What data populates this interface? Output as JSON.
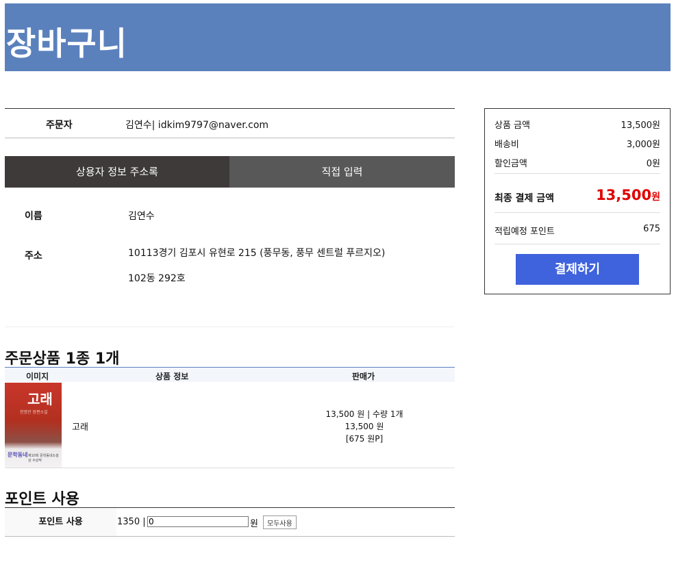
{
  "header": {
    "title": "장바구니"
  },
  "orderer": {
    "label": "주문자",
    "value": "김연수| idkim9797@naver.com"
  },
  "address_tabs": [
    {
      "label": "상용자 정보 주소록"
    },
    {
      "label": "직접 입력"
    }
  ],
  "recipient": {
    "name_label": "이름",
    "name_value": "김연수",
    "address_label": "주소",
    "address_line1": "10113경기 김포시 유현로 215 (풍무동, 풍무 센트럴 푸르지오)",
    "address_line2": "102동 292호"
  },
  "products": {
    "heading": "주문상품 1종 1개",
    "columns": [
      "이미지",
      "상품 정보",
      "판매가"
    ],
    "items": [
      {
        "cover_title": "고래",
        "cover_subtitle": "천명관 장편소설",
        "cover_logo": "문학동네",
        "cover_footer": "제10회 문학동네소설상 수상작",
        "name": "고래",
        "price_line": "13,500 원 | 수량 1개",
        "subtotal": "13,500 원",
        "points": "[675 원P]"
      }
    ]
  },
  "points_use": {
    "heading": "포인트 사용",
    "label": "포인트 사용",
    "available": "1350 |",
    "input_value": "0",
    "unit": "원",
    "use_all_label": "모두사용"
  },
  "summary": {
    "product_amount_label": "상품 금액",
    "product_amount": "13,500원",
    "shipping_label": "배송비",
    "shipping": "3,000원",
    "discount_label": "할인금액",
    "discount": "0원",
    "final_label": "최종 결제 금액",
    "final_amount": "13,500",
    "final_unit": "원",
    "points_label": "적립예정 포인트",
    "points": "675",
    "pay_label": "결제하기"
  },
  "colors": {
    "banner": "#5b81bd",
    "pay_button": "#3f62dd",
    "final_amount": "#e00000"
  }
}
